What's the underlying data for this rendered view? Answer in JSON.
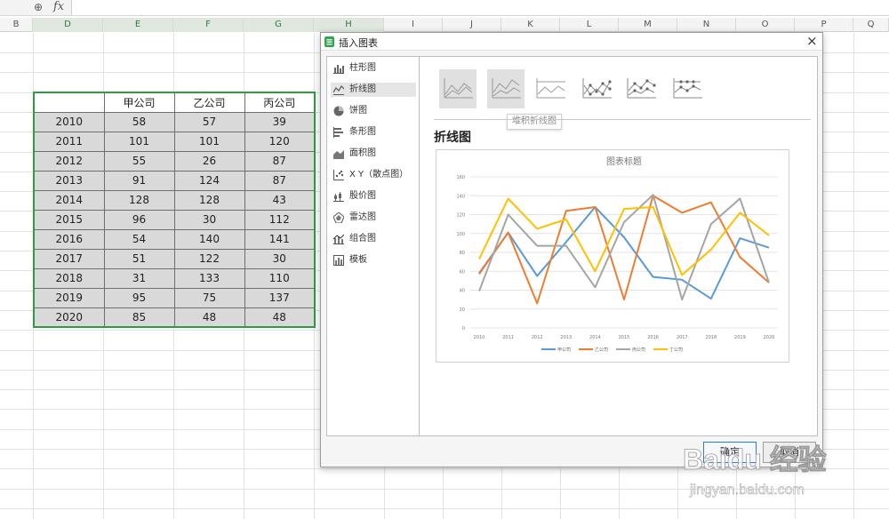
{
  "formula_bar": {
    "fx_label": "fx"
  },
  "columns": [
    "B",
    "D",
    "E",
    "F",
    "G",
    "H",
    "I",
    "J",
    "K",
    "L",
    "M",
    "N",
    "O",
    "P",
    "Q"
  ],
  "table": {
    "header": [
      "",
      "甲公司",
      "乙公司",
      "丙公司"
    ],
    "rows": [
      [
        "2010",
        "58",
        "57",
        "39"
      ],
      [
        "2011",
        "101",
        "101",
        "120"
      ],
      [
        "2012",
        "55",
        "26",
        "87"
      ],
      [
        "2013",
        "91",
        "124",
        "87"
      ],
      [
        "2014",
        "128",
        "128",
        "43"
      ],
      [
        "2015",
        "96",
        "30",
        "112"
      ],
      [
        "2016",
        "54",
        "140",
        "141"
      ],
      [
        "2017",
        "51",
        "122",
        "30"
      ],
      [
        "2018",
        "31",
        "133",
        "110"
      ],
      [
        "2019",
        "95",
        "75",
        "137"
      ],
      [
        "2020",
        "85",
        "48",
        "48"
      ]
    ]
  },
  "dialog": {
    "title": "插入图表",
    "close": "×",
    "chart_types": [
      "柱形图",
      "折线图",
      "饼图",
      "条形图",
      "面积图",
      "X Y（散点图）",
      "股价图",
      "雷达图",
      "组合图",
      "模板"
    ],
    "selected_type": "折线图",
    "tooltip": "堆积折线图",
    "section_title": "折线图",
    "ok_label": "确定",
    "cancel_label": "取消"
  },
  "chart_data": {
    "type": "line",
    "title": "图表标题",
    "x": [
      "2010",
      "2011",
      "2012",
      "2013",
      "2014",
      "2015",
      "2016",
      "2017",
      "2018",
      "2019",
      "2020"
    ],
    "ylim": [
      0,
      160
    ],
    "yticks": [
      "0",
      "20",
      "40",
      "60",
      "80",
      "100",
      "120",
      "140",
      "160"
    ],
    "grid": true,
    "legend": "bottom",
    "series": [
      {
        "name": "甲公司",
        "color": "#5b9bd5",
        "values": [
          58,
          101,
          55,
          91,
          128,
          96,
          54,
          51,
          31,
          95,
          85
        ]
      },
      {
        "name": "乙公司",
        "color": "#ed7d31",
        "values": [
          57,
          101,
          26,
          124,
          128,
          30,
          140,
          122,
          133,
          75,
          48
        ]
      },
      {
        "name": "丙公司",
        "color": "#a5a5a5",
        "values": [
          39,
          120,
          87,
          87,
          43,
          112,
          141,
          30,
          110,
          137,
          48
        ]
      },
      {
        "name": "丁公司",
        "color": "#ffc000",
        "values": [
          73,
          137,
          105,
          115,
          60,
          126,
          128,
          56,
          83,
          122,
          98
        ]
      }
    ]
  },
  "watermark": {
    "brand": "Baidu 经验",
    "url": "jingyan.baidu.com"
  }
}
